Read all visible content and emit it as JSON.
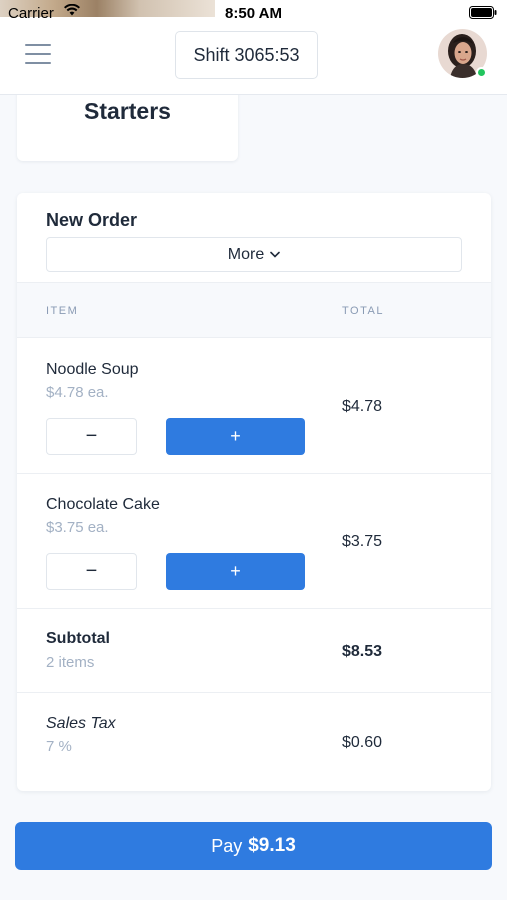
{
  "status_bar": {
    "carrier": "Carrier",
    "time": "8:50 AM"
  },
  "header": {
    "shift_label": "Shift 3065:53",
    "avatar_status_color": "#22c55e"
  },
  "category": {
    "title": "Starters"
  },
  "order": {
    "title": "New Order",
    "more_label": "More",
    "columns": {
      "item": "ITEM",
      "total": "TOTAL"
    },
    "items": [
      {
        "name": "Noodle Soup",
        "unit_price": "$4.78 ea.",
        "total": "$4.78",
        "minus": "−",
        "plus": "+"
      },
      {
        "name": "Chocolate Cake",
        "unit_price": "$3.75 ea.",
        "total": "$3.75",
        "minus": "−",
        "plus": "+"
      }
    ],
    "subtotal": {
      "label": "Subtotal",
      "count": "2 items",
      "value": "$8.53"
    },
    "tax": {
      "label": "Sales Tax",
      "rate": "7 %",
      "value": "$0.60"
    }
  },
  "pay": {
    "label": "Pay",
    "amount": "$9.13"
  },
  "colors": {
    "accent": "#2f7be0",
    "muted_text": "#a3b1c4",
    "online": "#22c55e"
  },
  "icons": {
    "menu": "menu-icon",
    "chevron": "chevron-down-icon",
    "wifi": "wifi-icon",
    "battery": "battery-icon"
  }
}
